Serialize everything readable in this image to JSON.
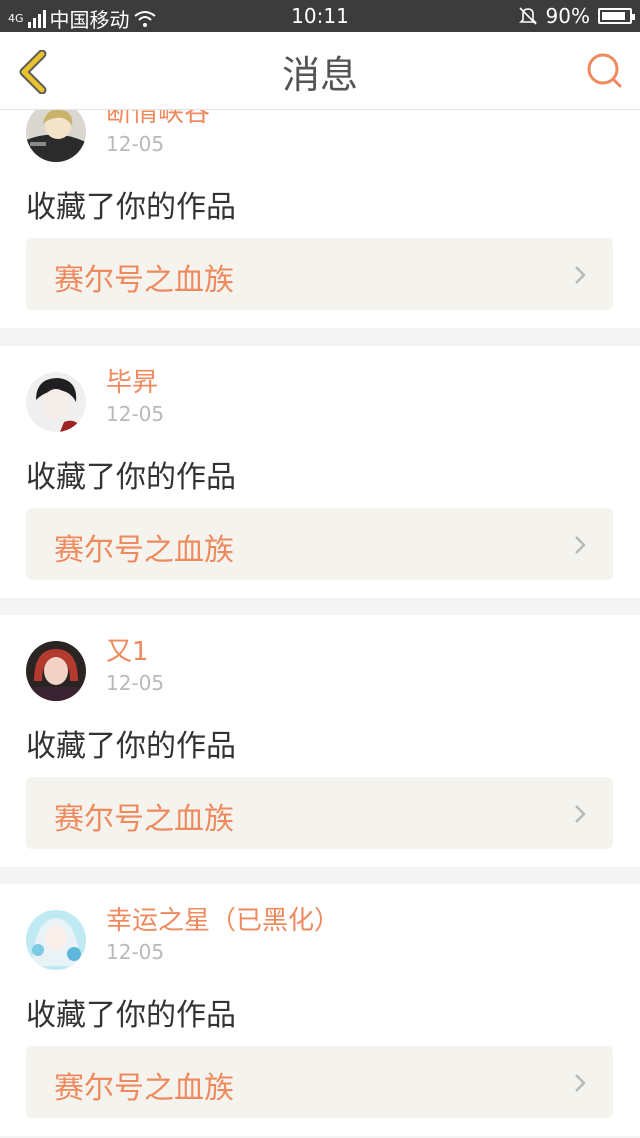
{
  "status_bar": {
    "network": "4G",
    "carrier": "中国移动",
    "time": "10:11",
    "battery": "90%",
    "battery_level": 0.9
  },
  "nav": {
    "title": "消息",
    "back_icon": "chevron-left-icon",
    "search_icon": "search-icon",
    "accent_color": "#ef8a5e",
    "back_color": "#e8c22a"
  },
  "messages": [
    {
      "username": "断情峡谷",
      "date": "12-05",
      "action": "收藏了你的作品",
      "work_title": "赛尔号之血族",
      "avatar": "avatar-anime-blond"
    },
    {
      "username": "毕昇",
      "date": "12-05",
      "action": "收藏了你的作品",
      "work_title": "赛尔号之血族",
      "avatar": "avatar-anime-dark-hair"
    },
    {
      "username": "又1",
      "date": "12-05",
      "action": "收藏了你的作品",
      "work_title": "赛尔号之血族",
      "avatar": "avatar-photo-red-hair"
    },
    {
      "username": "幸运之星（已黑化）",
      "date": "12-05",
      "action": "收藏了你的作品",
      "work_title": "赛尔号之血族",
      "avatar": "avatar-anime-blue"
    }
  ]
}
